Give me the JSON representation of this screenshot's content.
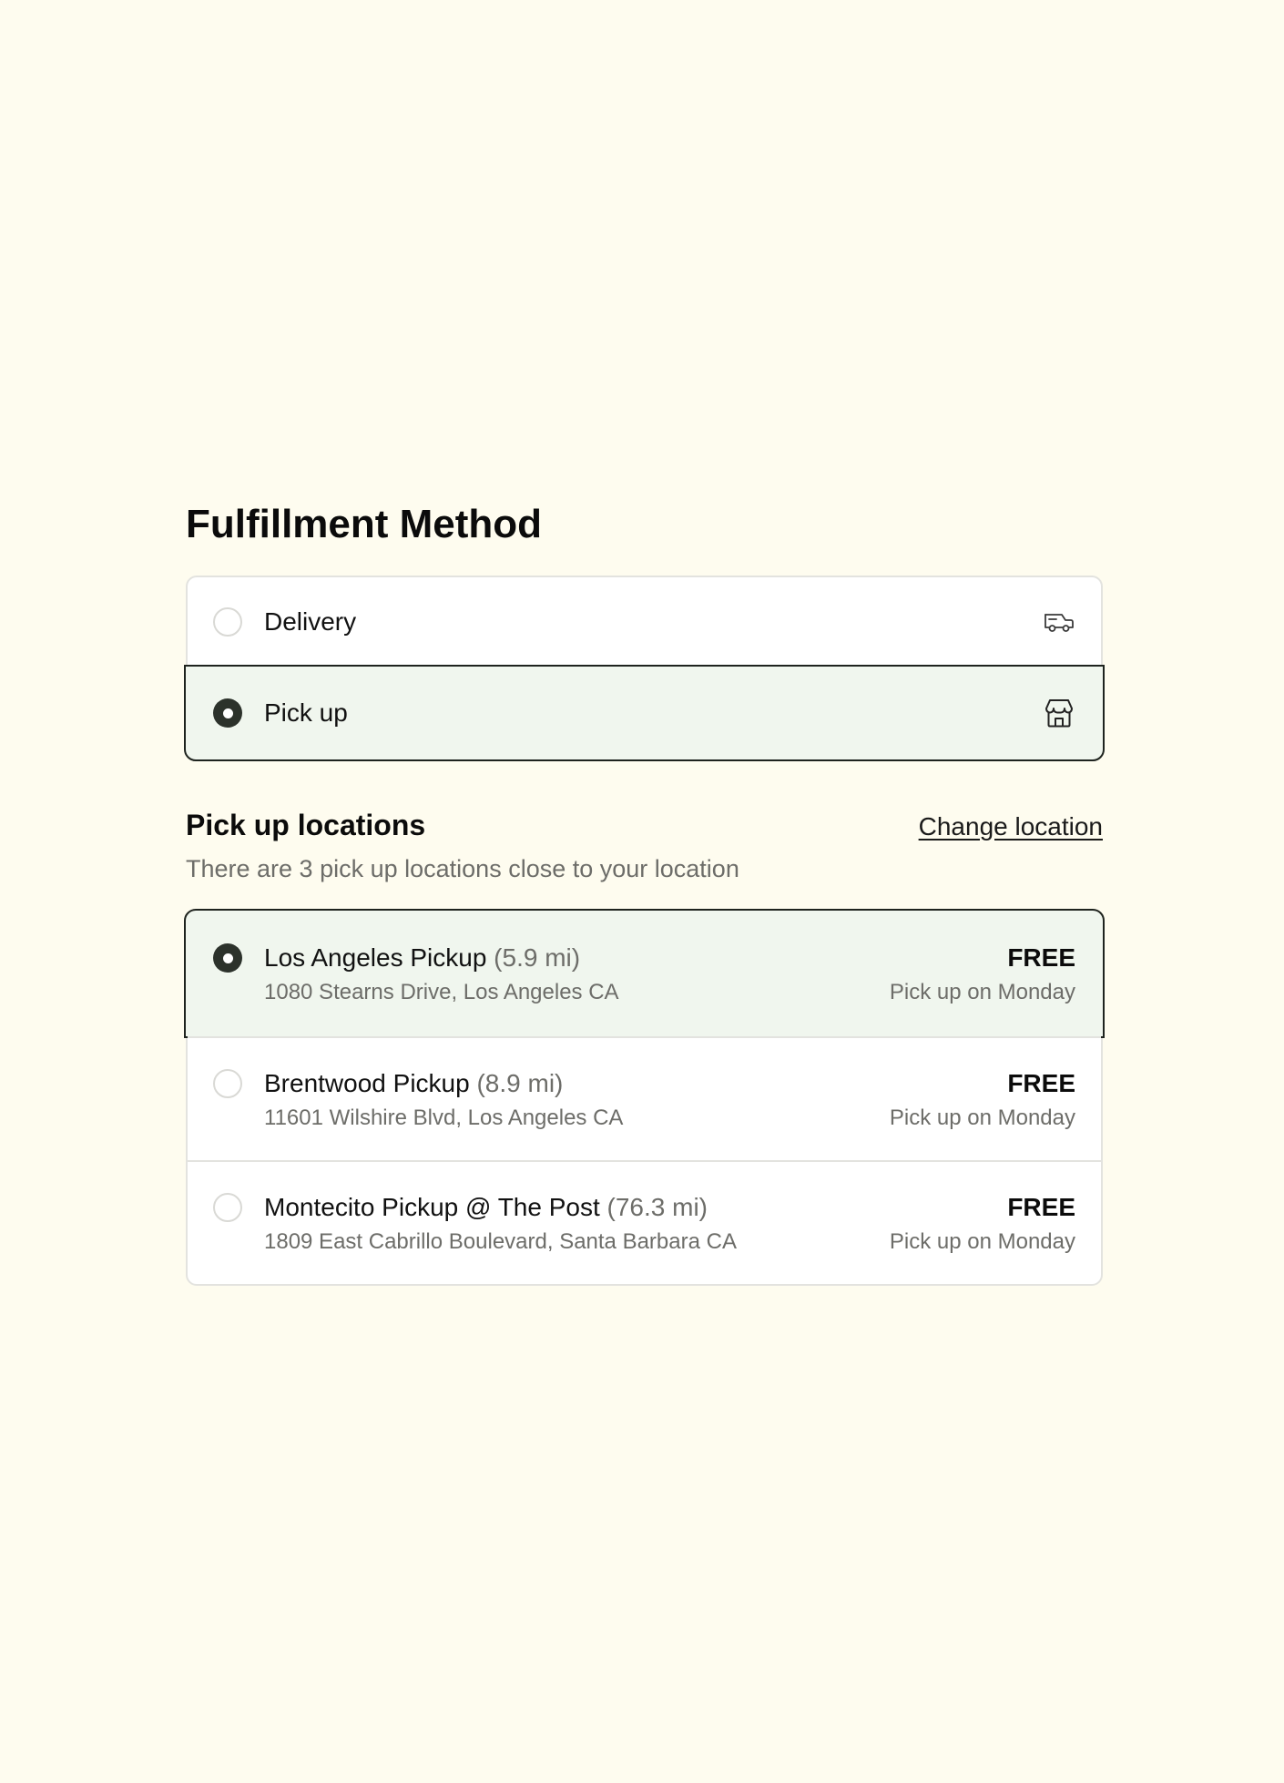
{
  "fulfillment": {
    "title": "Fulfillment Method",
    "options": [
      {
        "label": "Delivery",
        "icon": "truck-icon",
        "selected": false
      },
      {
        "label": "Pick up",
        "icon": "store-icon",
        "selected": true
      }
    ]
  },
  "pickup": {
    "title": "Pick up locations",
    "change_link": "Change location",
    "subtitle": "There are 3 pick up locations close to your location",
    "locations": [
      {
        "name": "Los Angeles Pickup",
        "distance": "(5.9 mi)",
        "address": "1080 Stearns Drive, Los Angeles CA",
        "price": "FREE",
        "when": "Pick up on Monday",
        "selected": true
      },
      {
        "name": "Brentwood Pickup",
        "distance": "(8.9 mi)",
        "address": "11601 Wilshire Blvd, Los Angeles CA",
        "price": "FREE",
        "when": "Pick up on Monday",
        "selected": false
      },
      {
        "name": "Montecito Pickup @ The Post",
        "distance": "(76.3 mi)",
        "address": "1809 East Cabrillo Boulevard, Santa Barbara CA",
        "price": "FREE",
        "when": "Pick up on Monday",
        "selected": false
      }
    ]
  },
  "colors": {
    "page_background": "#fefcef",
    "selected_background": "#f0f6ee",
    "selected_border": "#1e231e",
    "radio_checked": "#2c322b",
    "muted_text": "#6d6d69"
  }
}
